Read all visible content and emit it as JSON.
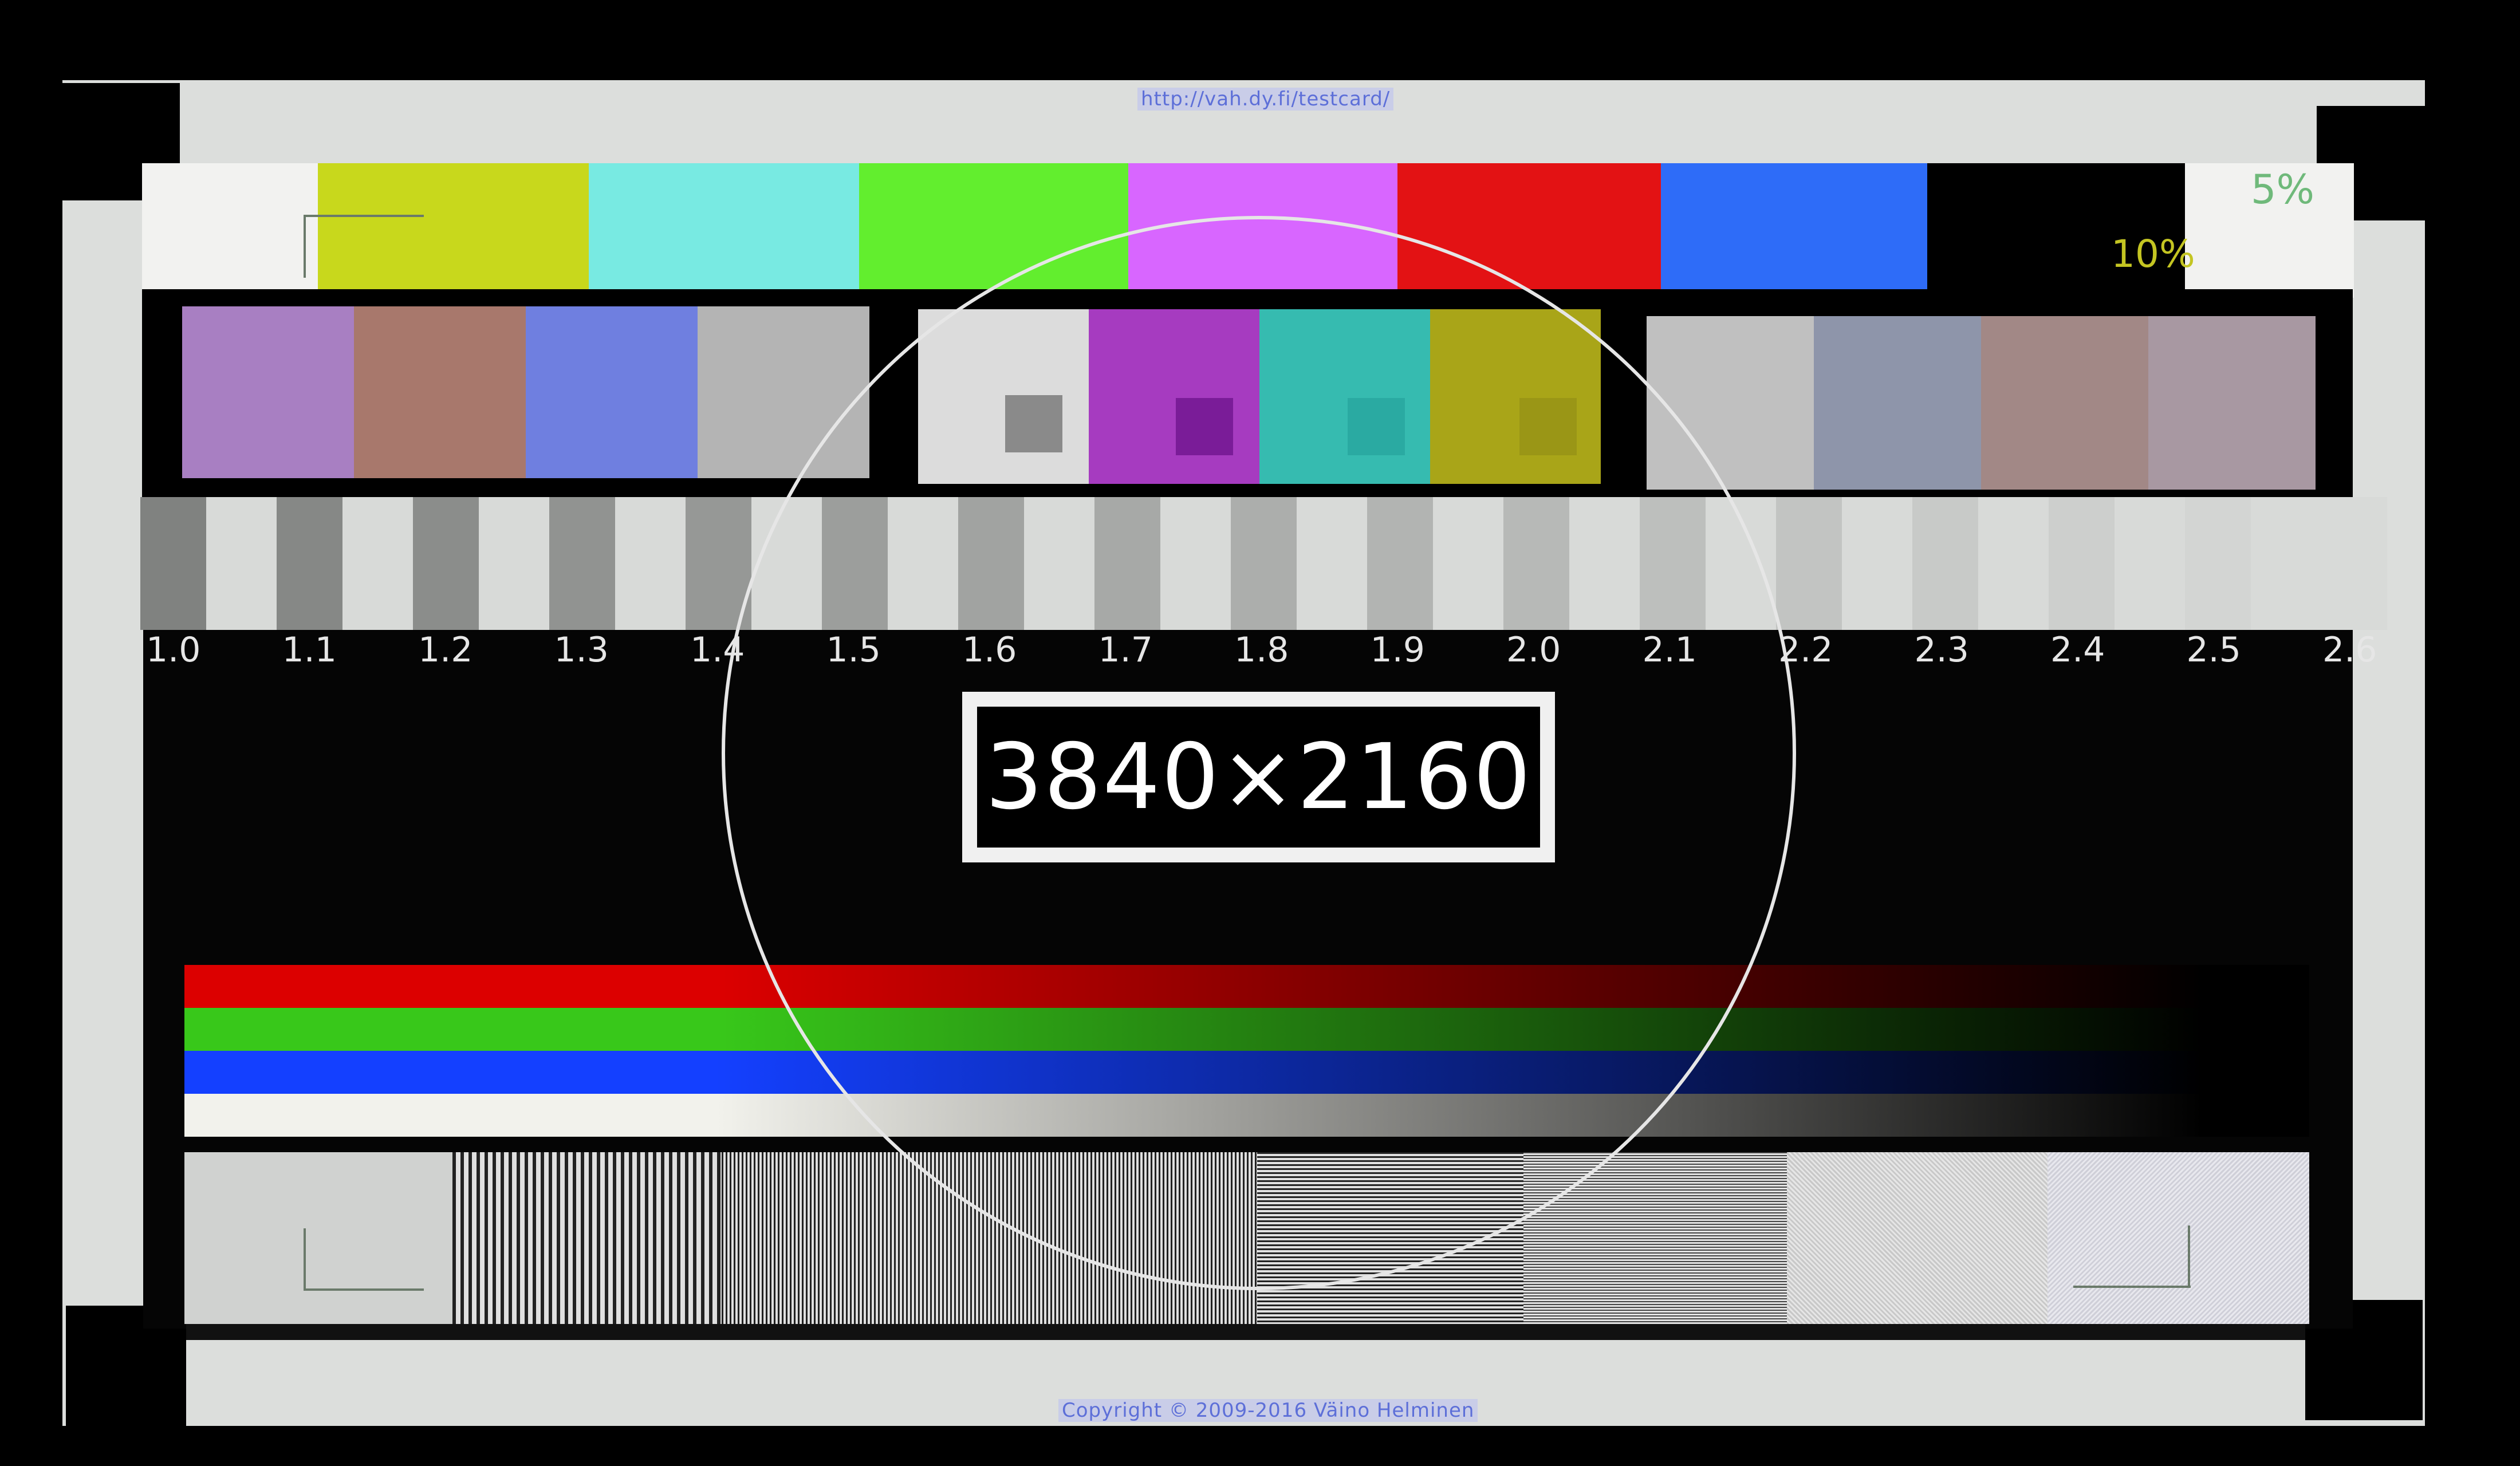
{
  "header": {
    "url": "http://vah.dy.fi/testcard/"
  },
  "footer": {
    "copyright": "Copyright © 2009-2016 Väino Helminen"
  },
  "resolution_label": "3840×2160",
  "percent_labels": {
    "low": "5%",
    "high": "10%"
  },
  "gamma_labels": [
    "1.0",
    "1.1",
    "1.2",
    "1.3",
    "1.4",
    "1.5",
    "1.6",
    "1.7",
    "1.8",
    "1.9",
    "2.0",
    "2.1",
    "2.2",
    "2.3",
    "2.4",
    "2.5",
    "2.6"
  ],
  "colors": {
    "top_bars": [
      "#f2f2f0",
      "#c8d81c",
      "#78eae2",
      "#62ee2e",
      "#d866ff",
      "#e31214",
      "#2e6cf8",
      "#000000",
      "#f2f2f0"
    ],
    "mid_group1": [
      "#a87fc2",
      "#a8786c",
      "#6f7fe0",
      "#b4b4b4"
    ],
    "mid_group2": [
      "#dcdcdc",
      "#a63bc0",
      "#36bbb0",
      "#a9a518"
    ],
    "mid_group3": [
      "#c0c0c0",
      "#8e95aa",
      "#a28886",
      "#a898a2"
    ],
    "gradients": [
      "#dc0000",
      "#38c81a",
      "#1440ff",
      "#f2f2ec"
    ]
  }
}
